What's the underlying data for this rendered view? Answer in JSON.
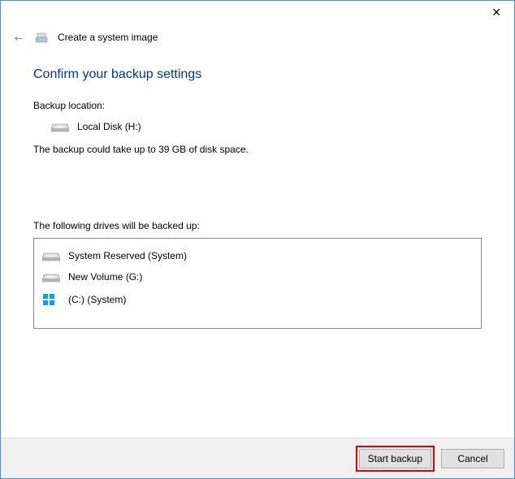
{
  "titlebar": {
    "close": "✕"
  },
  "header": {
    "back": "←",
    "title": "Create a system image"
  },
  "content": {
    "heading": "Confirm your backup settings",
    "location_label": "Backup location:",
    "location_value": "Local Disk (H:)",
    "size_text": "The backup could take up to 39 GB of disk space.",
    "drives_label": "The following drives will be backed up:",
    "drives": [
      {
        "name": "System Reserved (System)",
        "icon": "disk"
      },
      {
        "name": "New Volume (G:)",
        "icon": "disk"
      },
      {
        "name": "(C:) (System)",
        "icon": "windows"
      }
    ]
  },
  "footer": {
    "start": "Start backup",
    "cancel": "Cancel"
  }
}
